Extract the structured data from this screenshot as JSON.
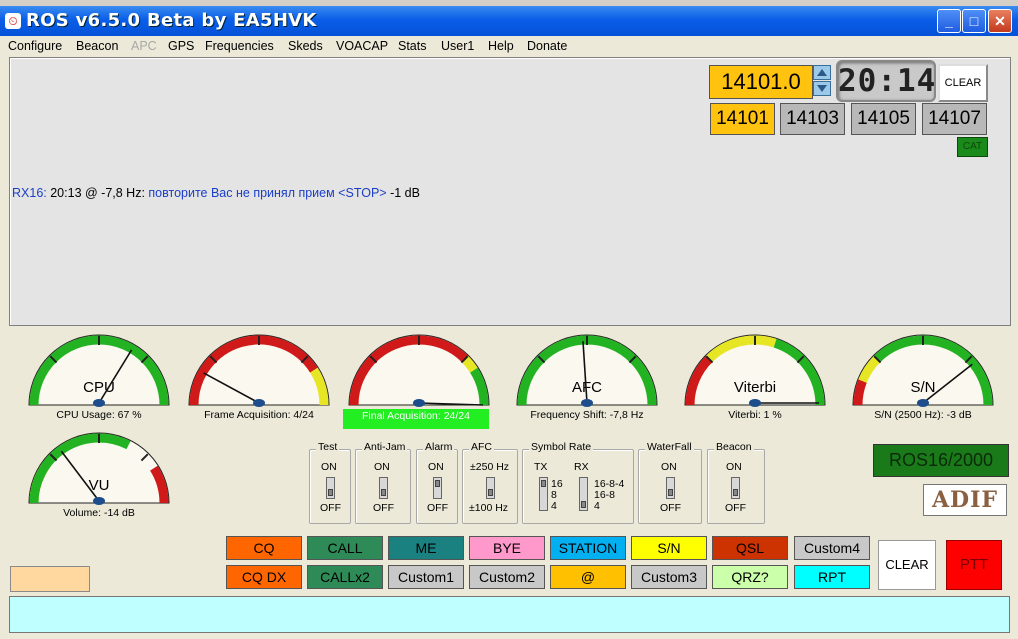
{
  "window": {
    "title": "ROS v6.5.0 Beta by EA5HVK",
    "controls": {
      "minimize": "_",
      "maximize": "□",
      "close": "✕"
    }
  },
  "menu": [
    "Configure",
    "Beacon",
    "APC",
    "GPS",
    "Frequencies",
    "Skeds",
    "VOACAP",
    "Stats",
    "User1",
    "Help",
    "Donate"
  ],
  "disabled_menu": [
    "APC"
  ],
  "frequency": {
    "current": "14101.0",
    "clock": "20:14",
    "clear_label": "CLEAR",
    "presets": [
      "14101",
      "14103",
      "14105",
      "14107"
    ],
    "active_preset": "14101",
    "cat_label": "CAT"
  },
  "rx": {
    "prefix": "RX16:",
    "time_offset": "20:13 @ -7,8 Hz:",
    "message": "повторите Вас не принял прием <STOP>",
    "snr": "-1 dB"
  },
  "meters": [
    {
      "label": "CPU",
      "caption": "CPU Usage: 67 %",
      "value": 0.67
    },
    {
      "label": "",
      "caption": "Frame Acquisition: 4/24",
      "value": 0.167
    },
    {
      "label": "",
      "caption": "Final Acquisition: 24/24",
      "value": 1.0,
      "highlight": true
    },
    {
      "label": "AFC",
      "caption": "Frequency Shift: -7,8 Hz",
      "value": 0.48
    },
    {
      "label": "Viterbi",
      "caption": "Viterbi: 1 %",
      "value": 0.99
    },
    {
      "label": "S/N",
      "caption": "S/N (2500 Hz): -3 dB",
      "value": 0.78
    },
    {
      "label": "VU",
      "caption": "Volume: -14 dB",
      "value": 0.3
    }
  ],
  "switches": {
    "test": {
      "title": "Test",
      "on": "ON",
      "off": "OFF"
    },
    "antijam": {
      "title": "Anti-Jam",
      "on": "ON",
      "off": "OFF"
    },
    "alarm": {
      "title": "Alarm",
      "on": "ON",
      "off": "OFF"
    },
    "afc": {
      "title": "AFC",
      "on": "±250 Hz",
      "off": "±100 Hz"
    },
    "symbol_rate": {
      "title": "Symbol Rate",
      "tx": "TX",
      "rx": "RX",
      "tx_values": [
        "16",
        "8",
        "4"
      ],
      "rx_values": [
        "16-8-4",
        "16-8",
        "4"
      ]
    },
    "waterfall": {
      "title": "WaterFall",
      "on": "ON",
      "off": "OFF"
    },
    "beacon": {
      "title": "Beacon",
      "on": "ON",
      "off": "OFF"
    }
  },
  "mode_badge": "ROS16/2000",
  "adif_label": "ADIF",
  "macros": [
    {
      "label": "CQ",
      "color": "#ff6600"
    },
    {
      "label": "CALL",
      "color": "#2e8b57"
    },
    {
      "label": "ME",
      "color": "#1a8080"
    },
    {
      "label": "BYE",
      "color": "#ff99cc"
    },
    {
      "label": "STATION",
      "color": "#00b0f0"
    },
    {
      "label": "S/N",
      "color": "#ffff00"
    },
    {
      "label": "QSL",
      "color": "#cc3300"
    },
    {
      "label": "Custom4",
      "color": "#c8c8c8"
    },
    {
      "label": "CQ DX",
      "color": "#ff6600"
    },
    {
      "label": "CALLx2",
      "color": "#2e8b57"
    },
    {
      "label": "Custom1",
      "color": "#c8c8c8"
    },
    {
      "label": "Custom2",
      "color": "#c8c8c8"
    },
    {
      "label": "@",
      "color": "#ffc000"
    },
    {
      "label": "Custom3",
      "color": "#c8c8c8"
    },
    {
      "label": "QRZ?",
      "color": "#ccffaa"
    },
    {
      "label": "RPT",
      "color": "#00ffff"
    }
  ],
  "clear_button": "CLEAR",
  "ptt_button": "PTT"
}
